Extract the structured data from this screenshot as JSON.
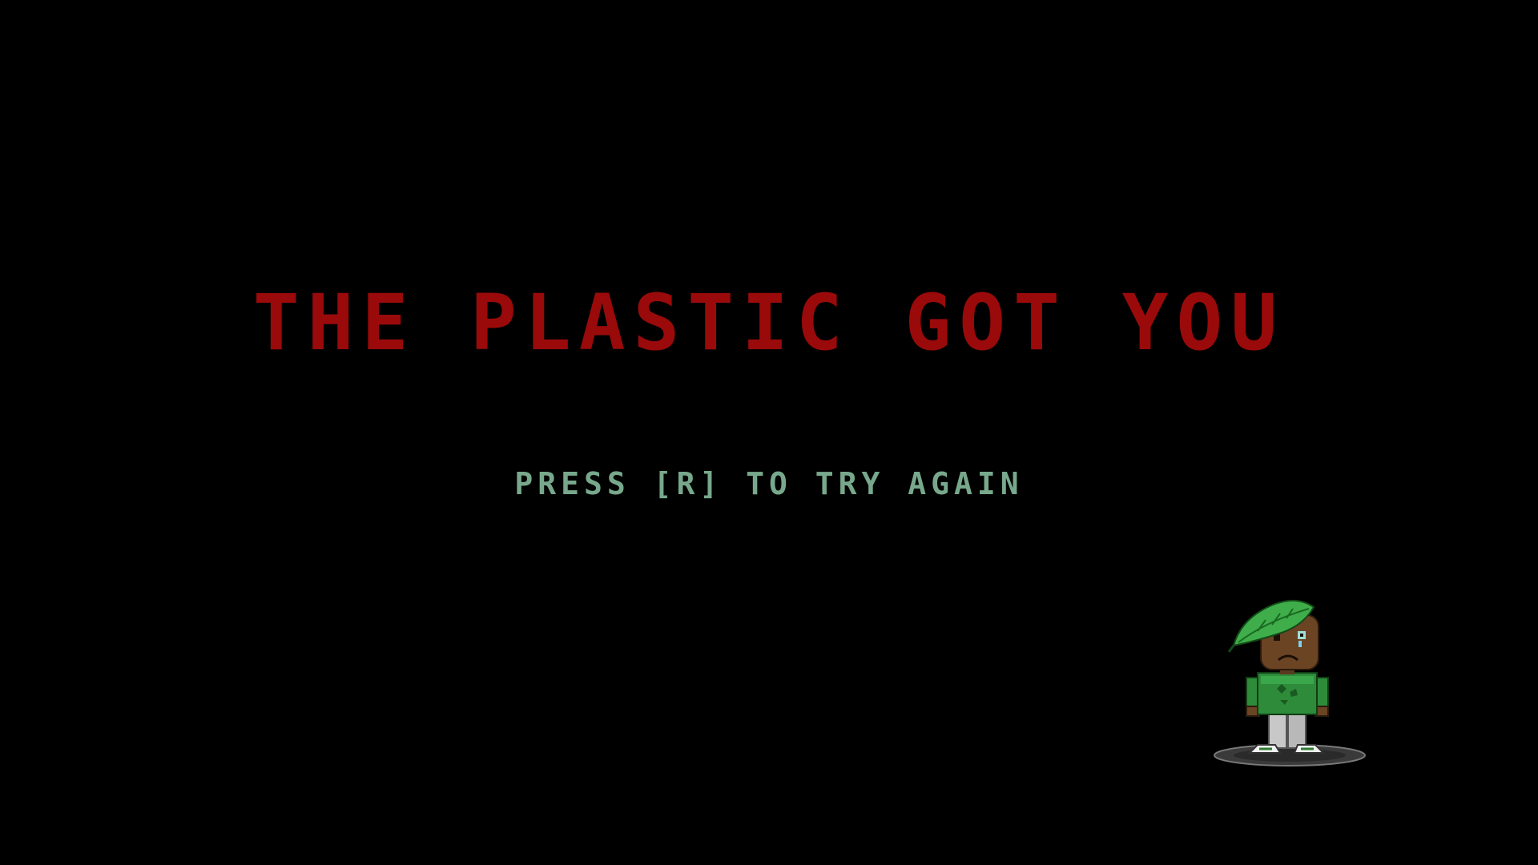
{
  "game": {
    "title": "THE PLASTIC GOT YOU",
    "prompt": "PRESS [R] TO TRY AGAIN"
  },
  "colors": {
    "background": "#000000",
    "title": "#9a0a0a",
    "prompt": "#78a88c"
  },
  "sprite": {
    "name": "leaf-hat-character",
    "state": "sad"
  }
}
